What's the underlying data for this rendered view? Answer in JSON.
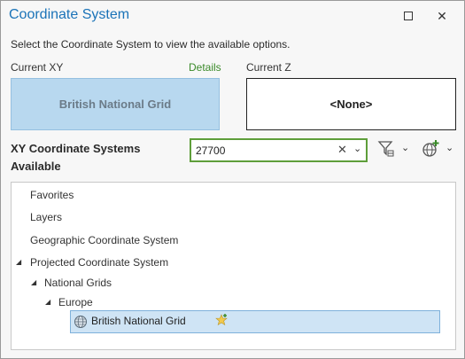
{
  "window": {
    "title": "Coordinate System"
  },
  "instructions": "Select the Coordinate System to view the available options.",
  "current_xy": {
    "label": "Current XY",
    "details_link": "Details",
    "value": "British National Grid"
  },
  "current_z": {
    "label": "Current Z",
    "value": "<None>"
  },
  "xy_section": {
    "title": "XY Coordinate Systems Available"
  },
  "search": {
    "value": "27700",
    "clear_glyph": "✕"
  },
  "tree": {
    "items": [
      {
        "label": "Favorites"
      },
      {
        "label": "Layers"
      },
      {
        "label": "Geographic Coordinate System"
      },
      {
        "label": "Projected Coordinate System"
      },
      {
        "label": "National Grids"
      },
      {
        "label": "Europe"
      }
    ],
    "selected": {
      "label": "British National Grid",
      "icon": "globe-icon",
      "badge": "favorite-star-icon"
    }
  },
  "colors": {
    "title": "#1a73b8",
    "details": "#3a8a29",
    "xy_card_bg": "#b8d8ef",
    "search_border": "#5e9e3a",
    "selected_row_bg": "#cfe4f5"
  }
}
